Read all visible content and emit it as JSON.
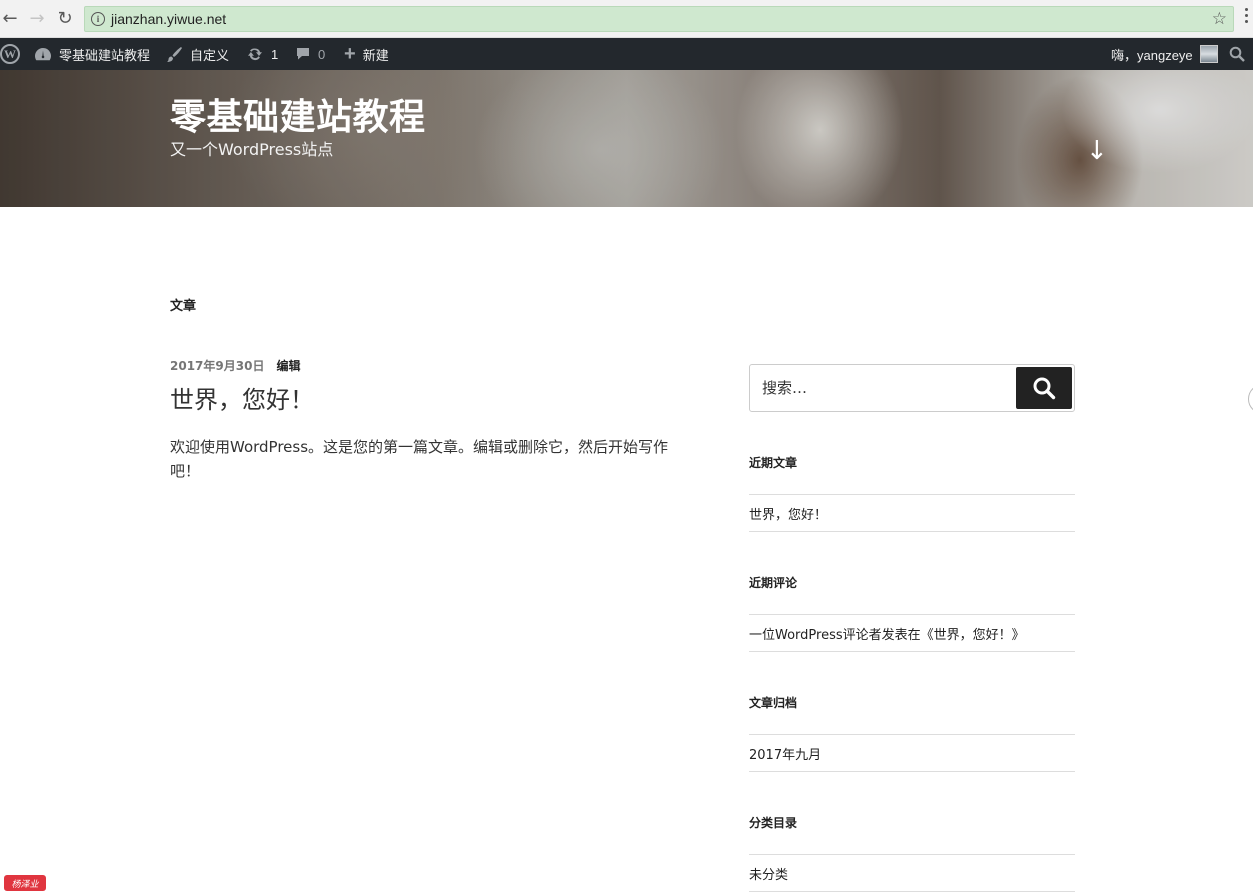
{
  "browser": {
    "url": "jianzhan.yiwue.net",
    "back_icon": "←",
    "forward_icon": "→",
    "reload_icon": "↻",
    "info_icon": "i",
    "star_icon": "☆"
  },
  "adminbar": {
    "site_name": "零基础建站教程",
    "customize": "自定义",
    "updates_count": "1",
    "comments_count": "0",
    "new_label": "新建",
    "greeting": "嗨，yangzeye"
  },
  "header": {
    "site_title": "零基础建站教程",
    "site_description": "又一个WordPress站点",
    "scroll_arrow": "↓"
  },
  "main": {
    "page_label": "文章",
    "post": {
      "date": "2017年9月30日",
      "edit": "编辑",
      "title": "世界，您好！",
      "excerpt": "欢迎使用WordPress。这是您的第一篇文章。编辑或删除它，然后开始写作吧！"
    }
  },
  "sidebar": {
    "search_placeholder": "搜索…",
    "recent_posts": {
      "title": "近期文章",
      "items": [
        "世界，您好！"
      ]
    },
    "recent_comments": {
      "title": "近期评论",
      "items": [
        "一位WordPress评论者发表在《世界，您好！》"
      ]
    },
    "archives": {
      "title": "文章归档",
      "items": [
        "2017年九月"
      ]
    },
    "categories": {
      "title": "分类目录",
      "items": [
        "未分类"
      ]
    }
  },
  "watermark": {
    "text": "杨泽业"
  },
  "colors": {
    "adminbar_bg": "#23282d",
    "search_button_bg": "#222222",
    "address_bar_bg": "#cfe8cf"
  }
}
